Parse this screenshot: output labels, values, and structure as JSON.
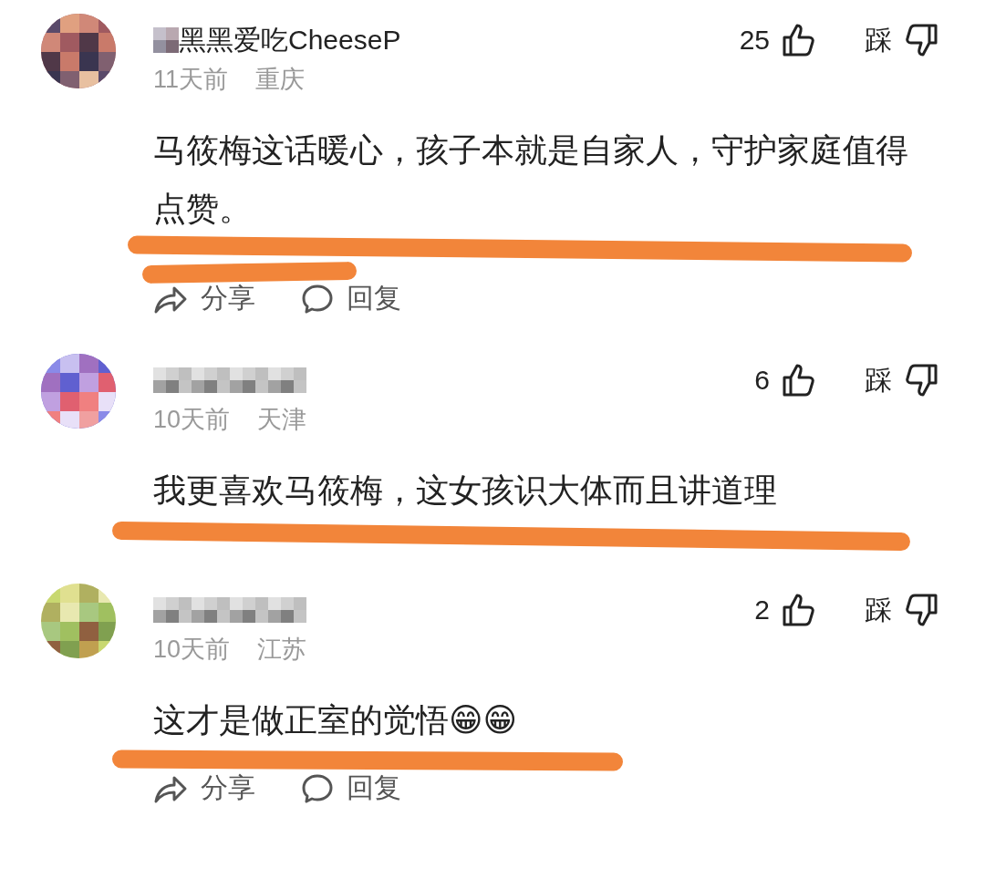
{
  "comments": [
    {
      "user": {
        "name": "黑黑爱吃CheeseP"
      },
      "time": "11天前",
      "location": "重庆",
      "likes": "25",
      "dislike_label": "踩",
      "text": "马筱梅这话暖心，孩子本就是自家人，守护家庭值得点赞。",
      "actions": [
        {
          "kind": "share",
          "label": "分享"
        },
        {
          "kind": "reply",
          "label": "回复"
        }
      ]
    },
    {
      "time": "10天前",
      "location": "天津",
      "likes": "6",
      "dislike_label": "踩",
      "text": "我更喜欢马筱梅，这女孩识大体而且讲道理"
    },
    {
      "time": "10天前",
      "location": "江苏",
      "likes": "2",
      "dislike_label": "踩",
      "text": "这才是做正室的觉悟😁😁",
      "actions": [
        {
          "kind": "share",
          "label": "分享"
        },
        {
          "kind": "reply",
          "label": "回复"
        }
      ]
    }
  ]
}
